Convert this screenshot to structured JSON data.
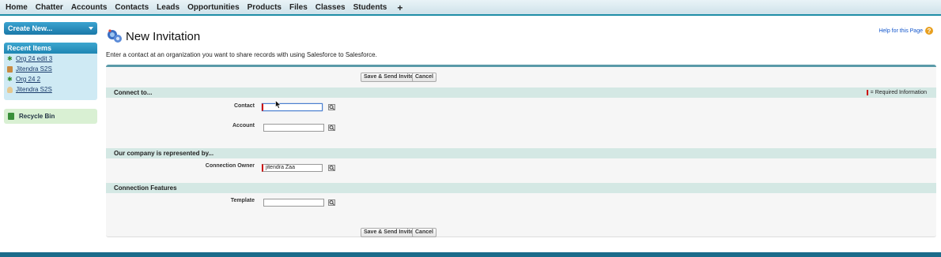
{
  "nav": {
    "tabs": [
      "Home",
      "Chatter",
      "Accounts",
      "Contacts",
      "Leads",
      "Opportunities",
      "Products",
      "Files",
      "Classes",
      "Students"
    ],
    "plus": "+"
  },
  "sidebar": {
    "create_new": "Create New...",
    "recent_title": "Recent Items",
    "recent_items": [
      {
        "label": "Org 24 edit 3",
        "icon": "connection-icon"
      },
      {
        "label": "Jitendra S2S",
        "icon": "account-icon"
      },
      {
        "label": "Org 24 2",
        "icon": "connection-icon"
      },
      {
        "label": "Jitendra S2S",
        "icon": "contact-icon"
      }
    ],
    "recycle_bin": "Recycle Bin"
  },
  "header": {
    "title": "New Invitation",
    "help": "Help for this Page",
    "intro": "Enter a contact at an organization you want to share records with using Salesforce to Salesforce."
  },
  "buttons": {
    "save_send": "Save & Send Invite",
    "cancel": "Cancel"
  },
  "sections": {
    "connect": "Connect to...",
    "required_info": "= Required Information",
    "company": "Our company is represented by...",
    "features": "Connection Features"
  },
  "fields": {
    "contact_label": "Contact",
    "contact_value": "",
    "account_label": "Account",
    "account_value": "",
    "owner_label": "Connection Owner",
    "owner_value": "jitendra Zaa",
    "template_label": "Template",
    "template_value": ""
  },
  "colors": {
    "accent": "#1f8ea7",
    "section": "#d4e8e4",
    "required": "#cc0000"
  }
}
